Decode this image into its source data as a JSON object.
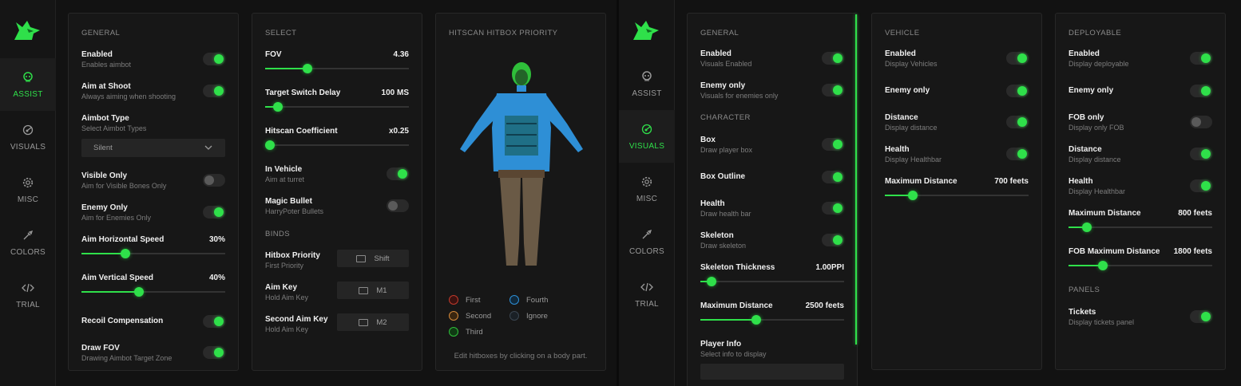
{
  "colors": {
    "accent": "#2fe04a",
    "bg": "#121212",
    "panel": "#171717"
  },
  "nav": [
    {
      "label": "ASSIST",
      "icon": "skull-icon"
    },
    {
      "label": "VISUALS",
      "icon": "radar-icon"
    },
    {
      "label": "MISC",
      "icon": "gear-icon"
    },
    {
      "label": "COLORS",
      "icon": "eyedropper-icon"
    },
    {
      "label": "TRIAL",
      "icon": "code-icon"
    }
  ],
  "assist": {
    "general": {
      "title": "GENERAL",
      "enabled": {
        "label": "Enabled",
        "sub": "Enables aimbot",
        "on": true
      },
      "aim_at_shoot": {
        "label": "Aim at Shoot",
        "sub": "Always aiming when shooting",
        "on": true
      },
      "aimbot_type": {
        "label": "Aimbot Type",
        "sub": "Select Aimbot Types",
        "value": "Silent"
      },
      "visible_only": {
        "label": "Visible Only",
        "sub": "Aim for Visible Bones Only",
        "on": false
      },
      "enemy_only": {
        "label": "Enemy Only",
        "sub": "Aim for Enemies Only",
        "on": true
      },
      "h_speed": {
        "label": "Aim Horizontal Speed",
        "value": "30%",
        "fraction": 0.29
      },
      "v_speed": {
        "label": "Aim Vertical Speed",
        "value": "40%",
        "fraction": 0.39
      },
      "recoil": {
        "label": "Recoil Compensation",
        "on": true
      },
      "draw_fov": {
        "label": "Draw FOV",
        "sub": "Drawing Aimbot Target Zone",
        "on": true
      }
    },
    "select": {
      "title": "SELECT",
      "fov": {
        "label": "FOV",
        "value": "4.36",
        "fraction": 0.28
      },
      "switch_delay": {
        "label": "Target Switch Delay",
        "value": "100 MS",
        "fraction": 0.06
      },
      "hitscan_coef": {
        "label": "Hitscan Coefficient",
        "value": "x0.25",
        "fraction": 0.0
      },
      "in_vehicle": {
        "label": "In Vehicle",
        "sub": "Aim at turret",
        "on": true
      },
      "magic_bullet": {
        "label": "Magic Bullet",
        "sub": "HarryPoter Bullets",
        "on": false
      },
      "binds_title": "BINDS",
      "hitbox_priority": {
        "label": "Hitbox Priority",
        "sub": "First Priority",
        "key": "Shift"
      },
      "aim_key": {
        "label": "Aim Key",
        "sub": "Hold Aim Key",
        "key": "M1"
      },
      "second_aim_key": {
        "label": "Second Aim Key",
        "sub": "Hold Aim Key",
        "key": "M2"
      }
    },
    "hitscan": {
      "title": "HITSCAN HITBOX PRIORITY",
      "legend": [
        {
          "label": "First",
          "color": "#c0392b"
        },
        {
          "label": "Second",
          "color": "#d4893a"
        },
        {
          "label": "Third",
          "color": "#2fbf3a"
        },
        {
          "label": "Fourth",
          "color": "#2e8fd6"
        },
        {
          "label": "Ignore",
          "color": "#3a4550"
        }
      ],
      "hint": "Edit hitboxes by clicking on a body part."
    }
  },
  "visuals": {
    "general": {
      "title": "GENERAL",
      "enabled": {
        "label": "Enabled",
        "sub": "Visuals Enabled",
        "on": true
      },
      "enemy_only": {
        "label": "Enemy only",
        "sub": "Visuals for enemies only",
        "on": true
      },
      "character_title": "CHARACTER",
      "box": {
        "label": "Box",
        "sub": "Draw player box",
        "on": true
      },
      "box_outline": {
        "label": "Box Outline",
        "on": true
      },
      "health": {
        "label": "Health",
        "sub": "Draw health bar",
        "on": true
      },
      "skeleton": {
        "label": "Skeleton",
        "sub": "Draw skeleton",
        "on": true
      },
      "skeleton_thickness": {
        "label": "Skeleton Thickness",
        "value": "1.00PPI",
        "fraction": 0.05
      },
      "max_distance": {
        "label": "Maximum Distance",
        "value": "2500 feets",
        "fraction": 0.38
      },
      "player_info": {
        "label": "Player Info",
        "sub": "Select info to display"
      }
    },
    "vehicle": {
      "title": "VEHICLE",
      "enabled": {
        "label": "Enabled",
        "sub": "Display Vehicles",
        "on": true
      },
      "enemy_only": {
        "label": "Enemy only",
        "on": true
      },
      "distance": {
        "label": "Distance",
        "sub": "Display distance",
        "on": true
      },
      "health": {
        "label": "Health",
        "sub": "Display Healthbar",
        "on": true
      },
      "max_distance": {
        "label": "Maximum Distance",
        "value": "700 feets",
        "fraction": 0.17
      }
    },
    "deployable": {
      "title": "DEPLOYABLE",
      "enabled": {
        "label": "Enabled",
        "sub": "Display deployable",
        "on": true
      },
      "enemy_only": {
        "label": "Enemy only",
        "on": true
      },
      "fob_only": {
        "label": "FOB only",
        "sub": "Display only FOB",
        "on": false
      },
      "distance": {
        "label": "Distance",
        "sub": "Display distance",
        "on": true
      },
      "health": {
        "label": "Health",
        "sub": "Display Healthbar",
        "on": true
      },
      "max_distance": {
        "label": "Maximum Distance",
        "value": "800 feets",
        "fraction": 0.1
      },
      "fob_max_distance": {
        "label": "FOB Maximum Distance",
        "value": "1800 feets",
        "fraction": 0.22
      },
      "panels_title": "PANELS",
      "tickets": {
        "label": "Tickets",
        "sub": "Display tickets panel",
        "on": true
      }
    }
  }
}
